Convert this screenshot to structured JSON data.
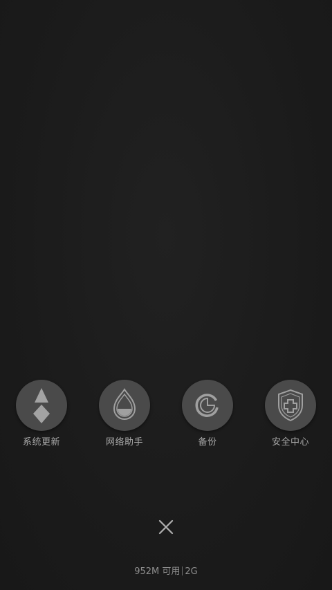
{
  "apps": [
    {
      "label": "系统更新",
      "icon": "system-update-icon"
    },
    {
      "label": "网络助手",
      "icon": "network-assistant-icon"
    },
    {
      "label": "备份",
      "icon": "backup-icon"
    },
    {
      "label": "安全中心",
      "icon": "security-center-icon"
    }
  ],
  "close": {
    "icon": "close-icon"
  },
  "status": {
    "memory_available": "952M 可用",
    "memory_total": "2G"
  },
  "colors": {
    "background": "#1b1b1b",
    "icon_circle": "#4a4a4a",
    "icon_glyph": "#a0a0a0",
    "label_text": "#a8a8a8"
  }
}
